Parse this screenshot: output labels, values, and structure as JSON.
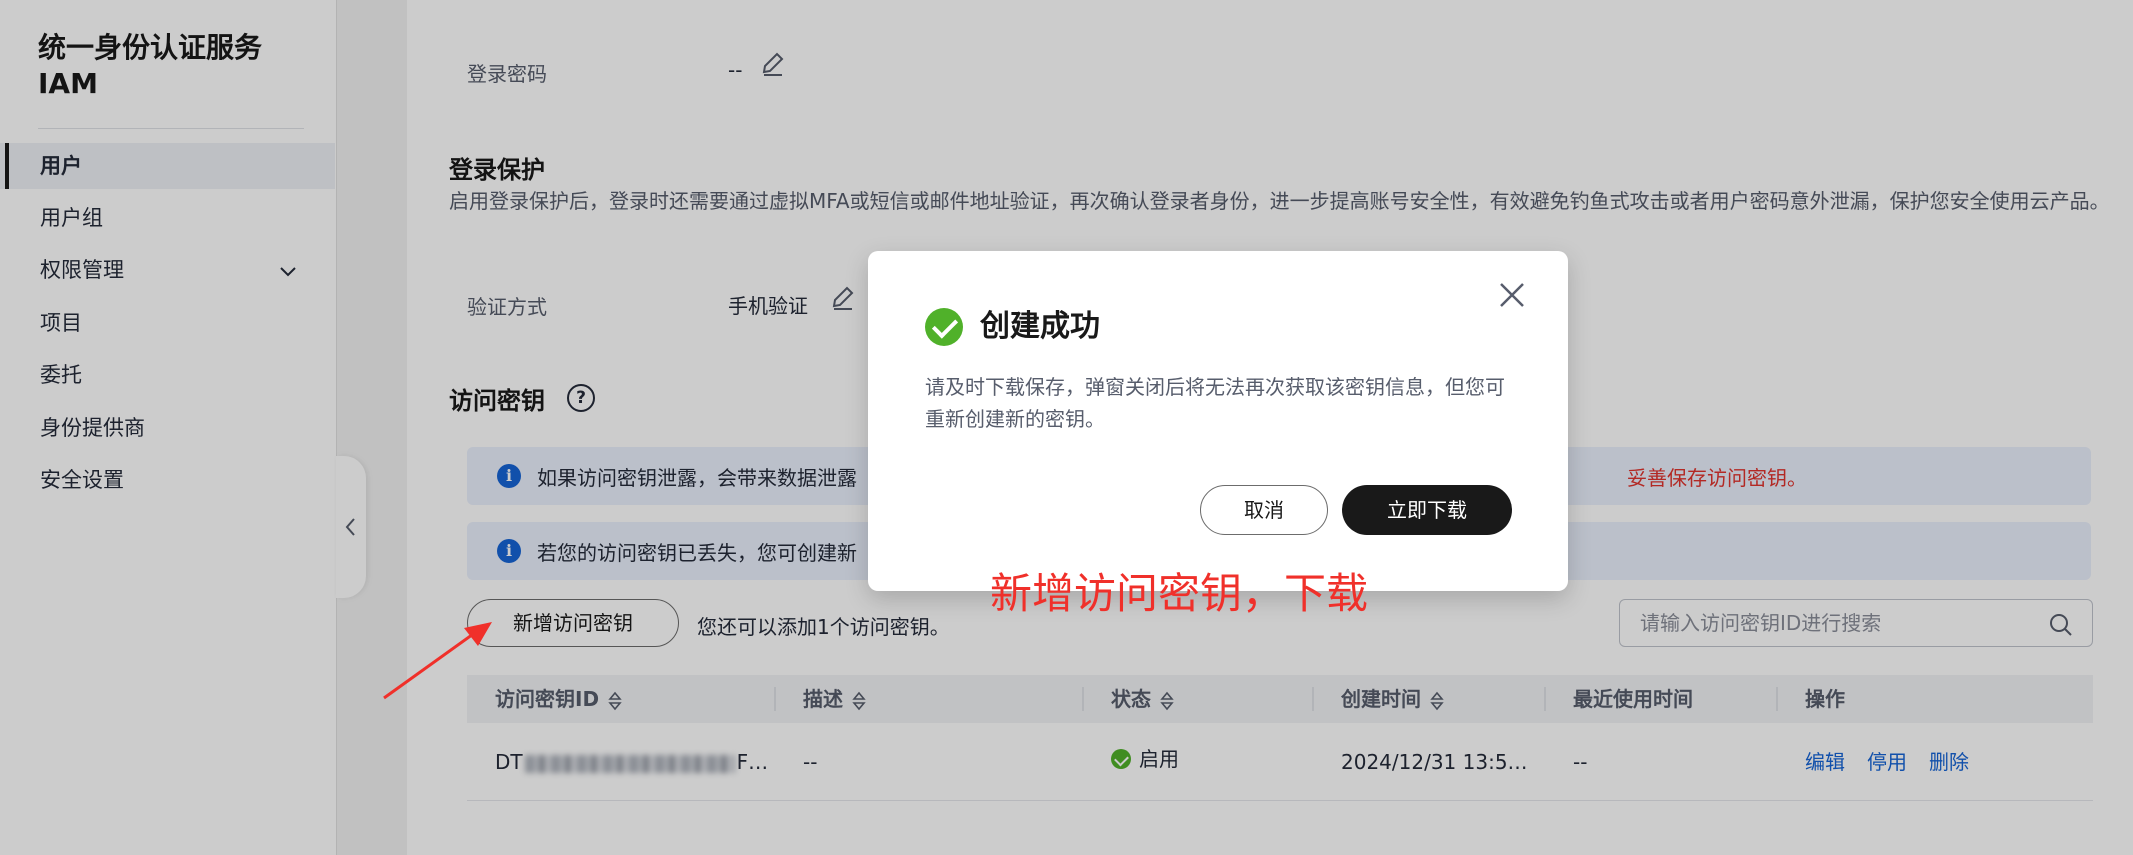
{
  "sidebar": {
    "title_line1": "统一身份认证服务",
    "title_line2": "IAM",
    "items": [
      {
        "label": "用户",
        "active": true
      },
      {
        "label": "用户组"
      },
      {
        "label": "权限管理",
        "expandable": true
      },
      {
        "label": "项目"
      },
      {
        "label": "委托"
      },
      {
        "label": "身份提供商"
      },
      {
        "label": "安全设置"
      }
    ]
  },
  "login_password": {
    "label": "登录密码",
    "value": "--"
  },
  "login_protection": {
    "title": "登录保护",
    "description": "启用登录保护后，登录时还需要通过虚拟MFA或短信或邮件地址验证，再次确认登录者身份，进一步提高账号安全性，有效避免钓鱼式攻击或者用户密码意外泄漏，保护您安全使用云产品。",
    "method_label": "验证方式",
    "method_value": "手机验证"
  },
  "access_keys": {
    "title": "访问密钥",
    "alert1_text": "如果访问密钥泄露，会带来数据泄露",
    "alert1_warning": "妥善保存访问密钥。",
    "alert2_text": "若您的访问密钥已丢失，您可创建新",
    "add_button": "新增访问密钥",
    "remaining_text": "您还可以添加1个访问密钥。",
    "search_placeholder": "请输入访问密钥ID进行搜索",
    "columns": [
      "访问密钥ID",
      "描述",
      "状态",
      "创建时间",
      "最近使用时间",
      "操作"
    ],
    "rows": [
      {
        "id_prefix": "DT",
        "id_suffix": "F…",
        "description": "--",
        "status": "启用",
        "created": "2024/12/31 13:5…",
        "last_used": "--",
        "actions": [
          "编辑",
          "停用",
          "删除"
        ]
      }
    ]
  },
  "dialog": {
    "title": "创建成功",
    "body": "请及时下载保存，弹窗关闭后将无法再次获取该密钥信息，但您可重新创建新的密钥。",
    "cancel": "取消",
    "download": "立即下载"
  },
  "annotation": "新增访问密钥，下载",
  "colors": {
    "accent": "#1664d6",
    "success": "#50b12a",
    "warning_text": "#e0342e",
    "primary_button": "#191919",
    "annotation": "#f0302a"
  }
}
